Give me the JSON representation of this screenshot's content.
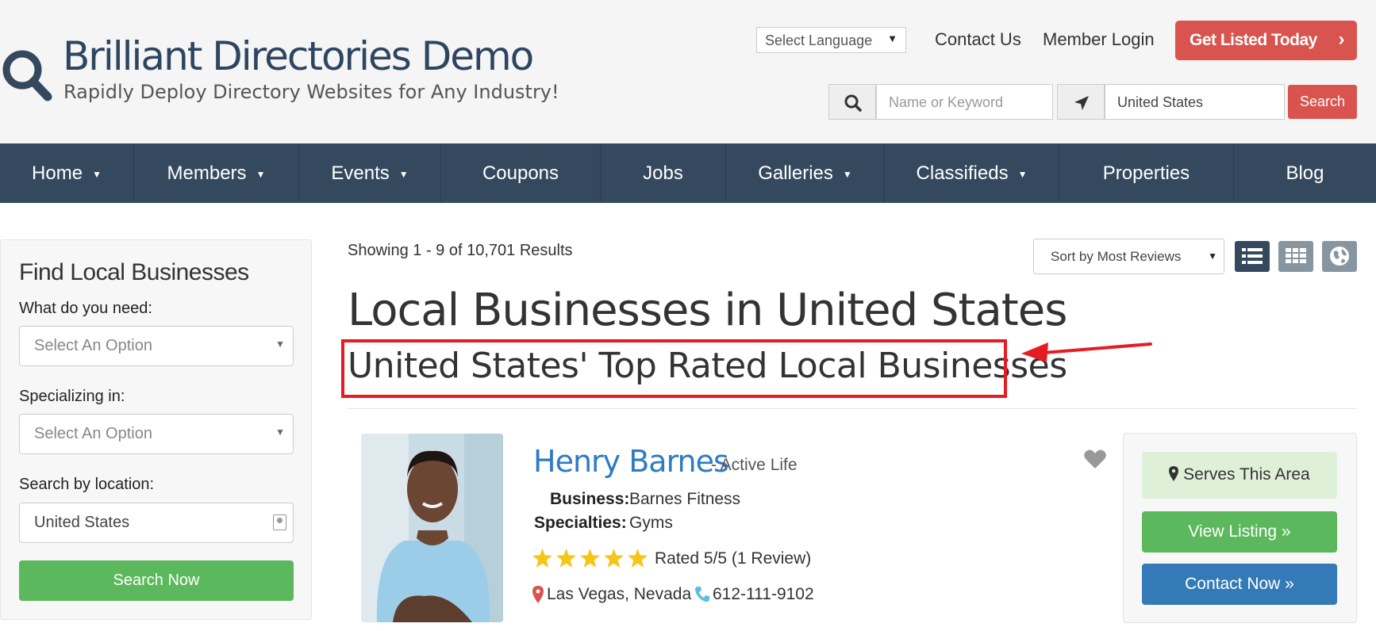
{
  "site": {
    "title": "Brilliant Directories Demo",
    "tagline": "Rapidly Deploy Directory Websites for Any Industry!",
    "logo_icon": "search-icon"
  },
  "header": {
    "language_select": "Select Language",
    "contact_link": "Contact Us",
    "member_login_link": "Member Login",
    "get_listed_button": "Get Listed Today",
    "search": {
      "keyword_placeholder": "Name or Keyword",
      "location_value": "United States",
      "button": "Search"
    }
  },
  "nav": {
    "items": [
      {
        "label": "Home",
        "dropdown": true
      },
      {
        "label": "Members",
        "dropdown": true
      },
      {
        "label": "Events",
        "dropdown": true
      },
      {
        "label": "Coupons",
        "dropdown": false
      },
      {
        "label": "Jobs",
        "dropdown": false
      },
      {
        "label": "Galleries",
        "dropdown": true
      },
      {
        "label": "Classifieds",
        "dropdown": true
      },
      {
        "label": "Properties",
        "dropdown": false
      },
      {
        "label": "Blog",
        "dropdown": false
      }
    ]
  },
  "sidebar": {
    "title": "Find Local Businesses",
    "need_label": "What do you need:",
    "need_value": "Select An Option",
    "specializing_label": "Specializing in:",
    "specializing_value": "Select An Option",
    "location_label": "Search by location:",
    "location_value": "United States",
    "search_button": "Search Now"
  },
  "main": {
    "results_count": "Showing 1 - 9 of 10,701 Results",
    "sort_value": "Sort by Most Reviews",
    "heading": "Local Businesses in United States",
    "subheading": "United States' Top Rated Local Businesses"
  },
  "listing": {
    "name": "Henry Barnes",
    "category": "- Active Life",
    "business_label": "Business:",
    "business_value": "Barnes Fitness",
    "specialties_label": "Specialties:",
    "specialties_value": "Gyms",
    "rating": 5,
    "rating_text": "Rated 5/5 (1 Review)",
    "location": "Las Vegas, Nevada",
    "phone": "612-111-9102",
    "serves_button": "Serves This Area",
    "view_button": "View Listing »",
    "contact_button": "Contact Now »"
  },
  "colors": {
    "brand_navy": "#34495e",
    "danger_red": "#d9534f",
    "success_green": "#5cb85c",
    "link_blue": "#337ab7",
    "highlight_red": "#e51c23"
  }
}
